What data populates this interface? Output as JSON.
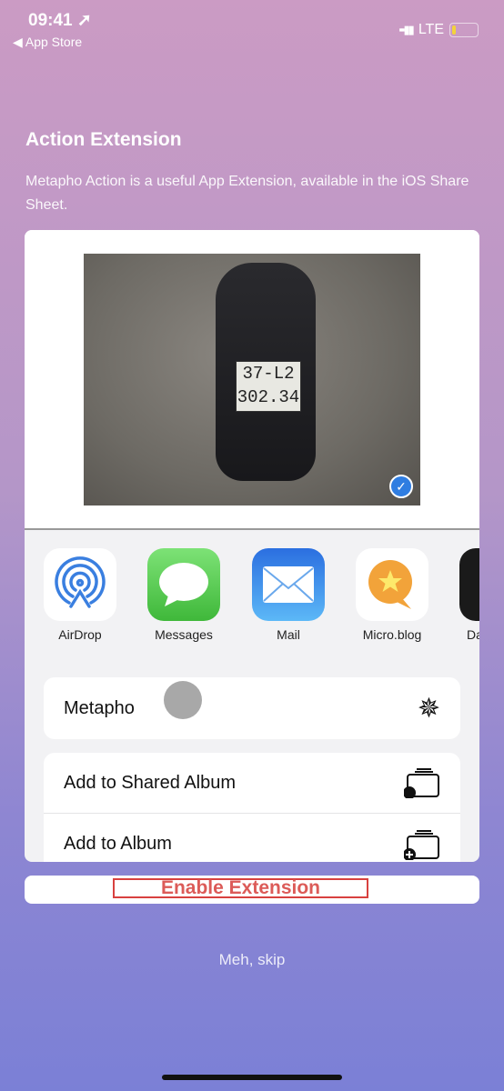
{
  "status_bar": {
    "time": "09:41",
    "back_label": "◀ App Store",
    "network": "LTE",
    "battery_level": 0.15
  },
  "title": "Action Extension",
  "description": "Metapho Action is a useful App Extension, available in the iOS Share Sheet.",
  "photo": {
    "plate_line1": "37-L2",
    "plate_line2": "302.34",
    "selected": true
  },
  "share_apps": [
    {
      "label": "AirDrop"
    },
    {
      "label": "Messages"
    },
    {
      "label": "Mail"
    },
    {
      "label": "Micro.blog"
    },
    {
      "label": "Da"
    }
  ],
  "actions": {
    "metapho": "Metapho",
    "shared_album": "Add to Shared Album",
    "album": "Add to Album"
  },
  "enable_button": "Enable Extension",
  "skip_link": "Meh, skip",
  "colors": {
    "accent_red": "#dc5b58",
    "bg_top": "#cb9bc4",
    "bg_bottom": "#7b80d6"
  }
}
